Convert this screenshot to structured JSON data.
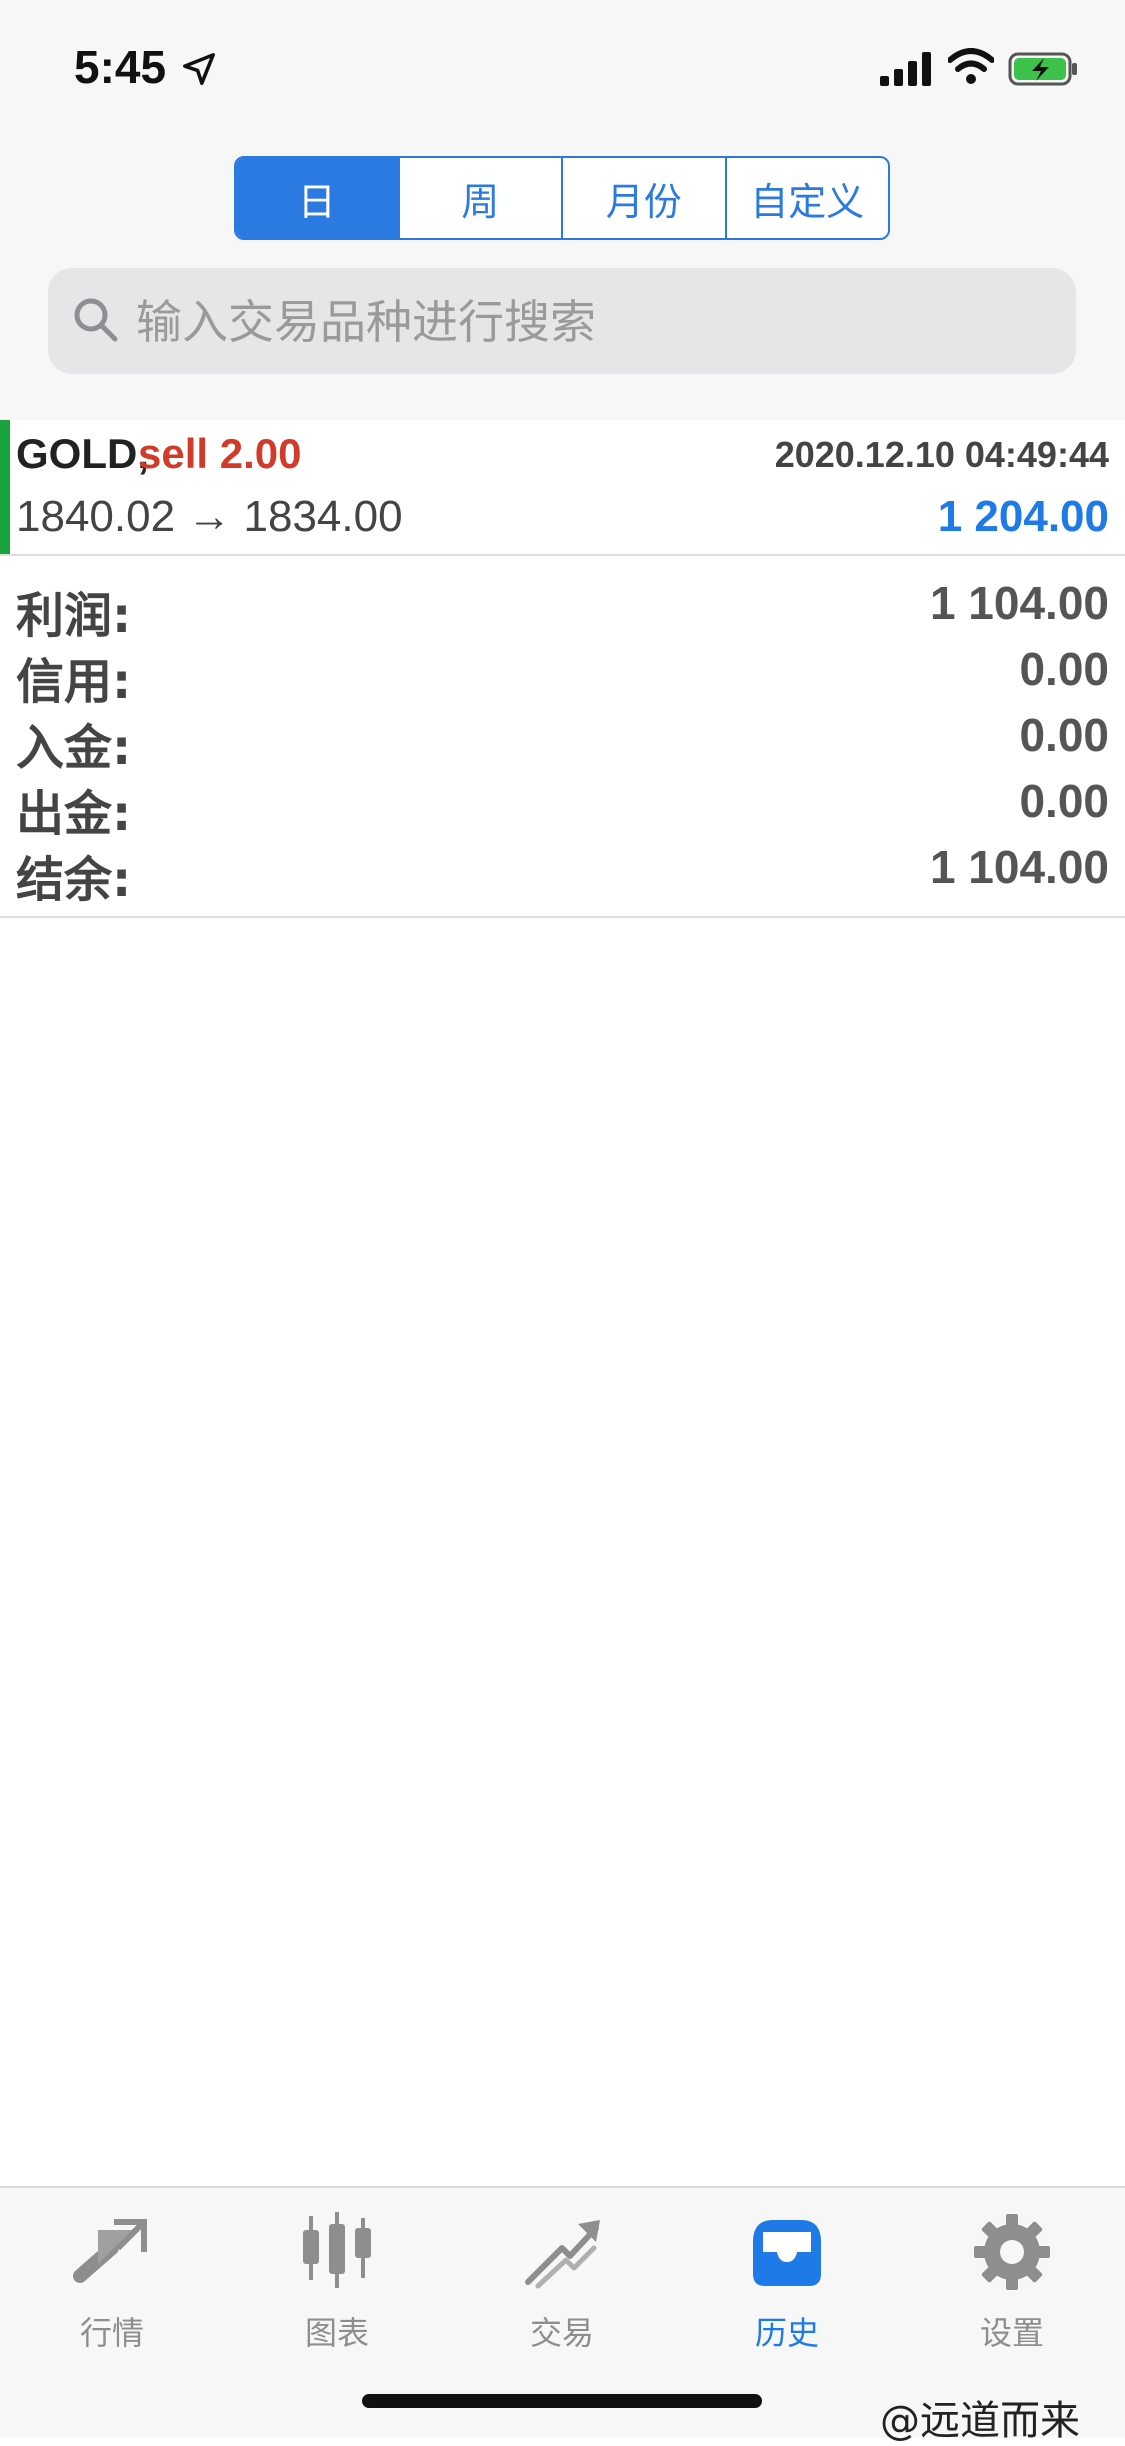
{
  "status_bar": {
    "time": "5:45"
  },
  "period_tabs": [
    {
      "label": "日",
      "active": true
    },
    {
      "label": "周",
      "active": false
    },
    {
      "label": "月份",
      "active": false
    },
    {
      "label": "自定义",
      "active": false
    }
  ],
  "search": {
    "placeholder": "输入交易品种进行搜索"
  },
  "trade": {
    "symbol": "GOLD,",
    "side": "sell 2.00",
    "datetime": "2020.12.10 04:49:44",
    "prices": "1840.02 → 1834.00",
    "profit": "1 204.00",
    "colors": {
      "marker": "#1aa33a",
      "side": "#d23a2a",
      "profit": "#1e7ae6"
    }
  },
  "summary": [
    {
      "label": "利润:",
      "value": "1 104.00"
    },
    {
      "label": "信用:",
      "value": "0.00"
    },
    {
      "label": "入金:",
      "value": "0.00"
    },
    {
      "label": "出金:",
      "value": "0.00"
    },
    {
      "label": "结余:",
      "value": "1 104.00"
    }
  ],
  "tabbar": [
    {
      "label": "行情",
      "icon": "quotes-icon",
      "active": false
    },
    {
      "label": "图表",
      "icon": "chart-icon",
      "active": false
    },
    {
      "label": "交易",
      "icon": "trade-icon",
      "active": false
    },
    {
      "label": "历史",
      "icon": "history-icon",
      "active": true
    },
    {
      "label": "设置",
      "icon": "settings-icon",
      "active": false
    }
  ],
  "watermark": "@远道而来",
  "accent_color": "#1e7ae6"
}
